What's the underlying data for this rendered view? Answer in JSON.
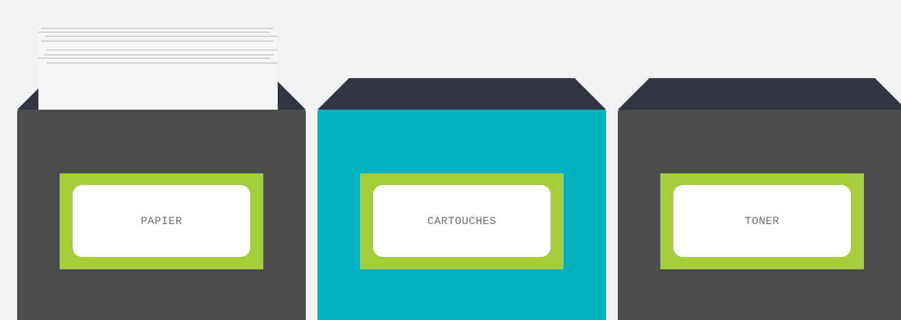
{
  "colors": {
    "background": "#f1f2f4",
    "lid": "#32343f",
    "bin_dark": "#4b4c4e",
    "bin_teal": "#00b0bf",
    "label_frame": "#a5cd39",
    "label_card": "#ffffff",
    "label_text": "#6b6e74",
    "paper": "#f5f6f5",
    "paper_lines": "#c6c7c9"
  },
  "bins": [
    {
      "label": "PAPIER",
      "color": "#4b4c4e",
      "selected": false
    },
    {
      "label": "CARTOUCHES",
      "color": "#00b0bf",
      "selected": true
    },
    {
      "label": "TONER",
      "color": "#4b4c4e",
      "selected": false
    }
  ],
  "icons": {
    "paper_stack": "paper-stack-icon"
  }
}
